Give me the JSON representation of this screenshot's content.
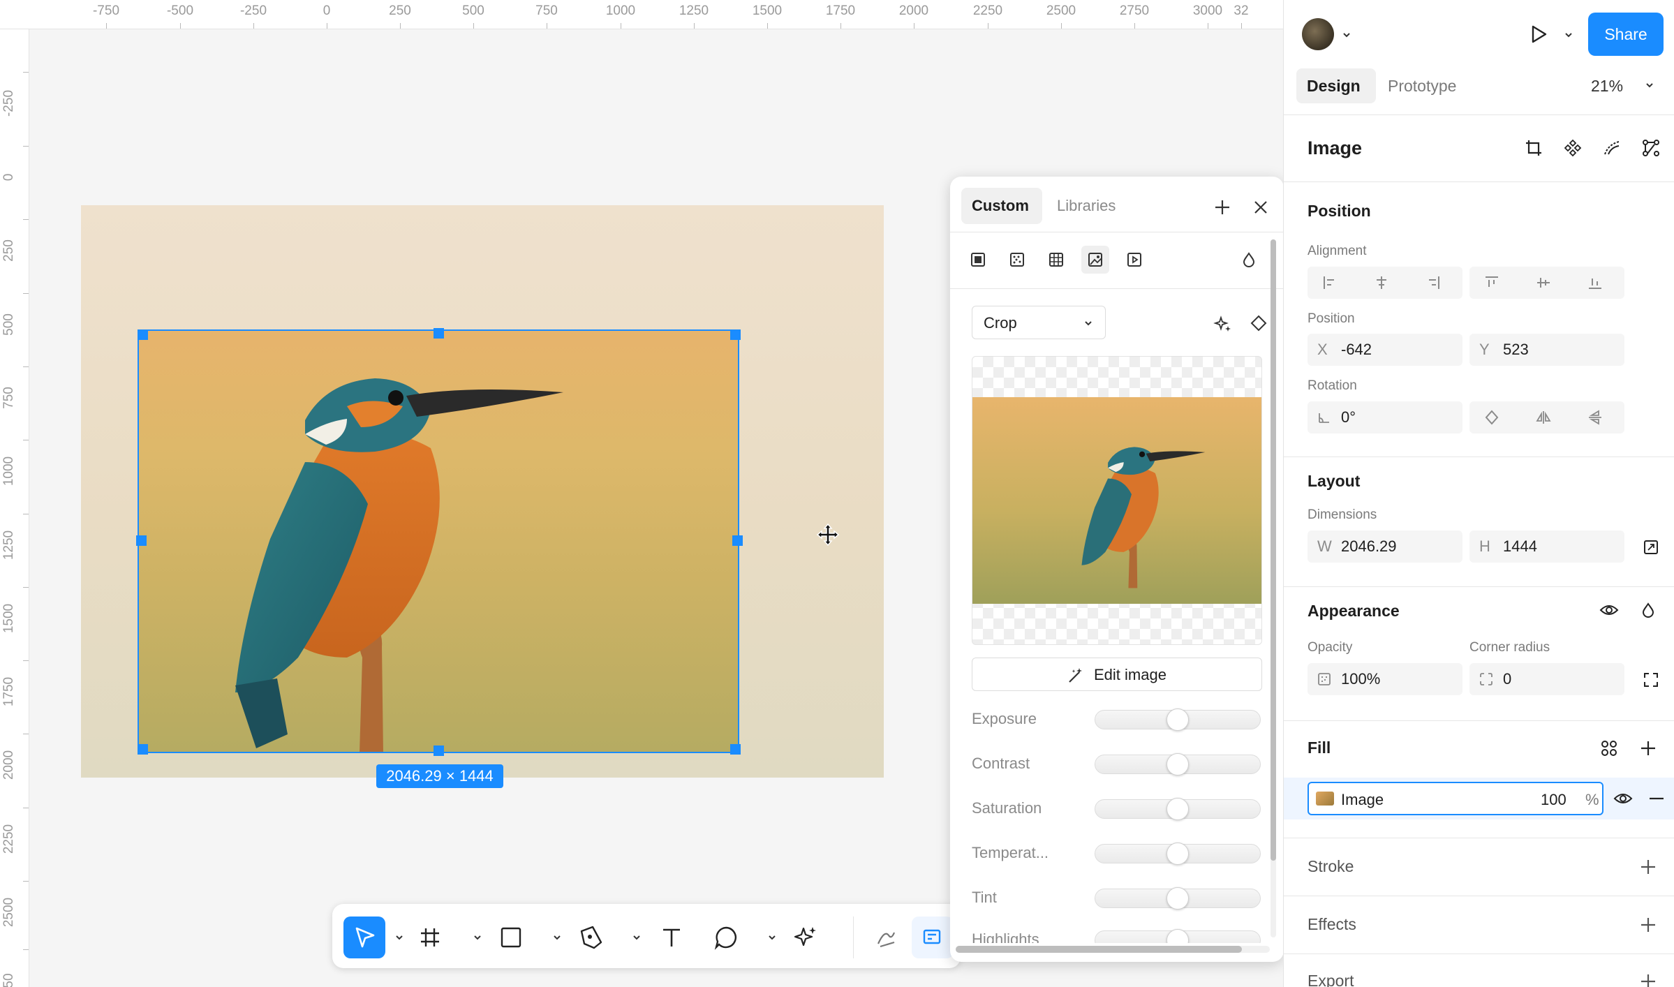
{
  "rulers": {
    "top": [
      "-750",
      "-500",
      "-250",
      "0",
      "250",
      "500",
      "750",
      "1000",
      "1250",
      "1500",
      "1750",
      "2000",
      "2250",
      "2500",
      "2750",
      "3000",
      "32"
    ],
    "left": [
      "-250",
      "0",
      "250",
      "500",
      "750",
      "1000",
      "1250",
      "1500",
      "1750",
      "2000",
      "2250",
      "2500",
      "50"
    ]
  },
  "canvas": {
    "dimension_badge": "2046.29 × 1444"
  },
  "popup": {
    "tabs": [
      "Custom",
      "Libraries"
    ],
    "active_tab": "Custom",
    "crop_label": "Crop",
    "edit_image_label": "Edit image",
    "sliders": [
      {
        "label": "Exposure",
        "value": 0.5
      },
      {
        "label": "Contrast",
        "value": 0.5
      },
      {
        "label": "Saturation",
        "value": 0.5
      },
      {
        "label": "Temperat...",
        "value": 0.5
      },
      {
        "label": "Tint",
        "value": 0.5
      },
      {
        "label": "Highlights",
        "value": 0.5
      }
    ]
  },
  "header": {
    "share_label": "Share",
    "tabs": [
      "Design",
      "Prototype"
    ],
    "active_tab": "Design",
    "zoom": "21%"
  },
  "panel": {
    "layer_type": "Image",
    "position": {
      "title": "Position",
      "alignment_label": "Alignment",
      "position_label": "Position",
      "x_prefix": "X",
      "x_value": "-642",
      "y_prefix": "Y",
      "y_value": "523",
      "rotation_label": "Rotation",
      "rotation_value": "0°"
    },
    "layout": {
      "title": "Layout",
      "dimensions_label": "Dimensions",
      "w_prefix": "W",
      "w_value": "2046.29",
      "h_prefix": "H",
      "h_value": "1444"
    },
    "appearance": {
      "title": "Appearance",
      "opacity_label": "Opacity",
      "opacity_value": "100%",
      "corner_label": "Corner radius",
      "corner_value": "0"
    },
    "fill": {
      "title": "Fill",
      "item_name": "Image",
      "item_opacity": "100",
      "item_unit": "%"
    },
    "stroke": {
      "title": "Stroke"
    },
    "effects": {
      "title": "Effects"
    },
    "export": {
      "title": "Export"
    }
  },
  "colors": {
    "accent": "#1a8cff",
    "canvas": "#f5f5f5"
  }
}
